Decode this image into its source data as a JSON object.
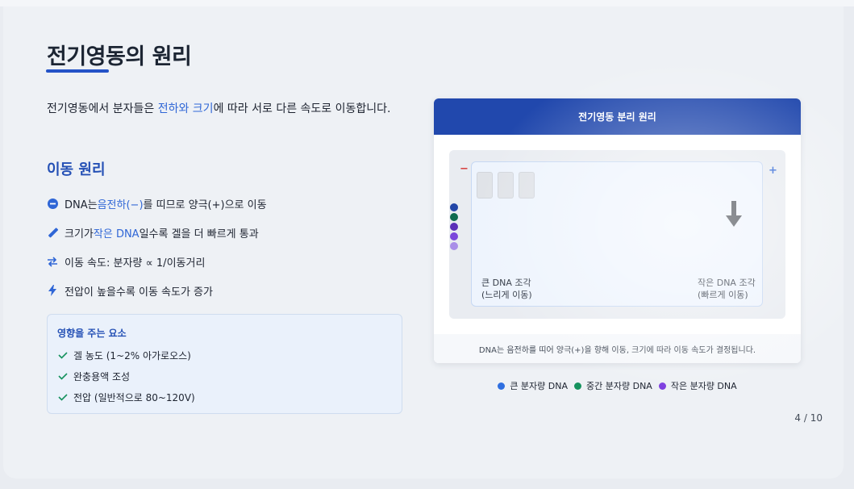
{
  "slide": {
    "title": "전기영동의 원리",
    "page_number": "4 / 10"
  },
  "intro": {
    "part1": "전기영동에서 분자들은 ",
    "highlight": "전하와 크기",
    "part2": "에 따라 서로 다른 속도로 이동합니다."
  },
  "subheading": "이동 원리",
  "bullets": [
    {
      "icon": "minus-circle-icon",
      "pre": "DNA는 ",
      "highlight": "음전하(−)",
      "post": "를 띠므로 양극(+)으로 이동"
    },
    {
      "icon": "ruler-icon",
      "pre": "크기가 ",
      "highlight": "작은 DNA",
      "post": "일수록 겔을 더 빠르게 통과"
    },
    {
      "icon": "exchange-arrows-icon",
      "pre": "이동 속도: 분자량 ∝ 1/이동거리",
      "highlight": "",
      "post": ""
    },
    {
      "icon": "bolt-icon",
      "pre": "전압이 높을수록 이동 속도가 증가",
      "highlight": "",
      "post": ""
    }
  ],
  "factors": {
    "title": "영향을 주는 요소",
    "items": [
      "겔 농도 (1~2% 아가로오스)",
      "완충용액 조성",
      "전압 (일반적으로 80~120V)"
    ]
  },
  "diagram": {
    "header": "전기영동 분리 원리",
    "minus_label": "−",
    "plus_label": "+",
    "large_fragment": [
      "큰 DNA 조각",
      "(느리게 이동)"
    ],
    "small_fragment": [
      "작은 DNA 조각",
      "(빠르게 이동)"
    ],
    "footer": "DNA는 음전하를 띠어 양극(+)을 향해 이동, 크기에 따라 이동 속도가 결정됩니다.",
    "dot_colors": [
      "#2346a8",
      "#0f6b4f",
      "#5b2fb8",
      "#7b47db",
      "#a98ee8"
    ]
  },
  "legend": [
    {
      "label": "큰 분자량 DNA",
      "color": "#2f6fe0"
    },
    {
      "label": "중간 분자량 DNA",
      "color": "#15925e"
    },
    {
      "label": "작은 분자량 DNA",
      "color": "#7d3ee0"
    }
  ],
  "colors": {
    "accent": "#2453c7",
    "highlight": "#2f66d6"
  }
}
